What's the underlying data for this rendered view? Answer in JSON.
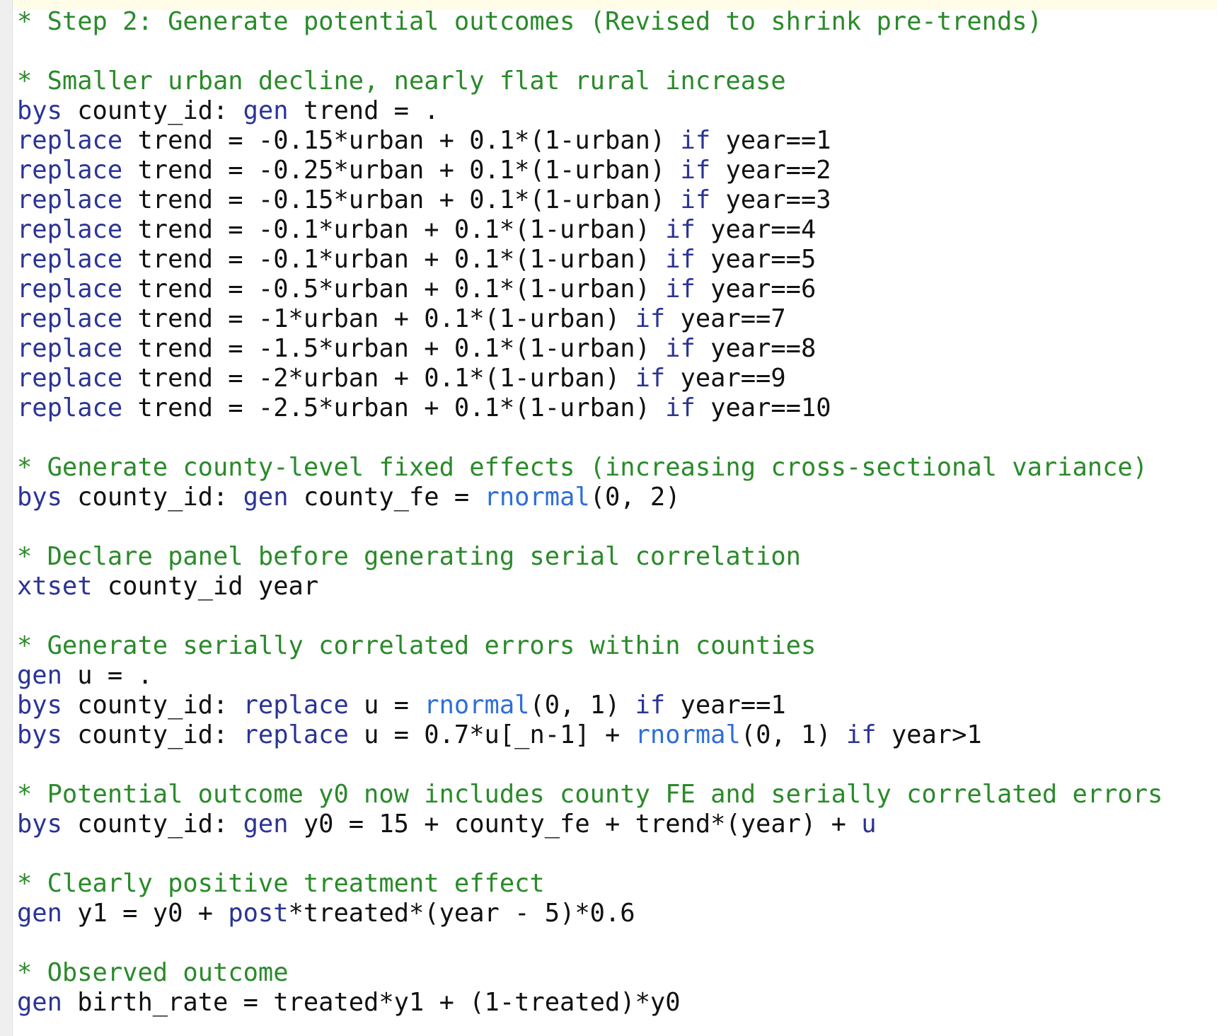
{
  "colors": {
    "comment": "#2a8a2a",
    "keyword": "#2b3494",
    "function": "#2e6fd8",
    "text": "#111111",
    "gutter": "#efefef",
    "background": "#ffffff"
  },
  "lines": [
    [
      {
        "t": "* Step 2: Generate potential outcomes (Revised to shrink pre-trends)",
        "c": "comment"
      }
    ],
    [],
    [
      {
        "t": "* Smaller urban decline, nearly flat rural increase",
        "c": "comment"
      }
    ],
    [
      {
        "t": "bys",
        "c": "kw"
      },
      {
        "t": " county_id: ",
        "c": "plain"
      },
      {
        "t": "gen",
        "c": "kw"
      },
      {
        "t": " trend = .",
        "c": "plain"
      }
    ],
    [
      {
        "t": "replace",
        "c": "kw"
      },
      {
        "t": " trend = -0.15*urban + 0.1*(1-urban) ",
        "c": "plain"
      },
      {
        "t": "if",
        "c": "kw"
      },
      {
        "t": " year==1",
        "c": "plain"
      }
    ],
    [
      {
        "t": "replace",
        "c": "kw"
      },
      {
        "t": " trend = -0.25*urban + 0.1*(1-urban) ",
        "c": "plain"
      },
      {
        "t": "if",
        "c": "kw"
      },
      {
        "t": " year==2",
        "c": "plain"
      }
    ],
    [
      {
        "t": "replace",
        "c": "kw"
      },
      {
        "t": " trend = -0.15*urban + 0.1*(1-urban) ",
        "c": "plain"
      },
      {
        "t": "if",
        "c": "kw"
      },
      {
        "t": " year==3",
        "c": "plain"
      }
    ],
    [
      {
        "t": "replace",
        "c": "kw"
      },
      {
        "t": " trend = -0.1*urban + 0.1*(1-urban) ",
        "c": "plain"
      },
      {
        "t": "if",
        "c": "kw"
      },
      {
        "t": " year==4",
        "c": "plain"
      }
    ],
    [
      {
        "t": "replace",
        "c": "kw"
      },
      {
        "t": " trend = -0.1*urban + 0.1*(1-urban) ",
        "c": "plain"
      },
      {
        "t": "if",
        "c": "kw"
      },
      {
        "t": " year==5",
        "c": "plain"
      }
    ],
    [
      {
        "t": "replace",
        "c": "kw"
      },
      {
        "t": " trend = -0.5*urban + 0.1*(1-urban) ",
        "c": "plain"
      },
      {
        "t": "if",
        "c": "kw"
      },
      {
        "t": " year==6",
        "c": "plain"
      }
    ],
    [
      {
        "t": "replace",
        "c": "kw"
      },
      {
        "t": " trend = -1*urban + 0.1*(1-urban) ",
        "c": "plain"
      },
      {
        "t": "if",
        "c": "kw"
      },
      {
        "t": " year==7",
        "c": "plain"
      }
    ],
    [
      {
        "t": "replace",
        "c": "kw"
      },
      {
        "t": " trend = -1.5*urban + 0.1*(1-urban) ",
        "c": "plain"
      },
      {
        "t": "if",
        "c": "kw"
      },
      {
        "t": " year==8",
        "c": "plain"
      }
    ],
    [
      {
        "t": "replace",
        "c": "kw"
      },
      {
        "t": " trend = -2*urban + 0.1*(1-urban) ",
        "c": "plain"
      },
      {
        "t": "if",
        "c": "kw"
      },
      {
        "t": " year==9",
        "c": "plain"
      }
    ],
    [
      {
        "t": "replace",
        "c": "kw"
      },
      {
        "t": " trend = -2.5*urban + 0.1*(1-urban) ",
        "c": "plain"
      },
      {
        "t": "if",
        "c": "kw"
      },
      {
        "t": " year==10",
        "c": "plain"
      }
    ],
    [],
    [
      {
        "t": "* Generate county-level fixed effects (increasing cross-sectional variance)",
        "c": "comment"
      }
    ],
    [
      {
        "t": "bys",
        "c": "kw"
      },
      {
        "t": " county_id: ",
        "c": "plain"
      },
      {
        "t": "gen",
        "c": "kw"
      },
      {
        "t": " county_fe = ",
        "c": "plain"
      },
      {
        "t": "rnormal",
        "c": "fn"
      },
      {
        "t": "(0, 2)",
        "c": "plain"
      }
    ],
    [],
    [
      {
        "t": "* Declare panel before generating serial correlation",
        "c": "comment"
      }
    ],
    [
      {
        "t": "xtset",
        "c": "kw"
      },
      {
        "t": " county_id year",
        "c": "plain"
      }
    ],
    [],
    [
      {
        "t": "* Generate serially correlated errors within counties",
        "c": "comment"
      }
    ],
    [
      {
        "t": "gen",
        "c": "kw"
      },
      {
        "t": " u = .",
        "c": "plain"
      }
    ],
    [
      {
        "t": "bys",
        "c": "kw"
      },
      {
        "t": " county_id: ",
        "c": "plain"
      },
      {
        "t": "replace",
        "c": "kw"
      },
      {
        "t": " u = ",
        "c": "plain"
      },
      {
        "t": "rnormal",
        "c": "fn"
      },
      {
        "t": "(0, 1) ",
        "c": "plain"
      },
      {
        "t": "if",
        "c": "kw"
      },
      {
        "t": " year==1",
        "c": "plain"
      }
    ],
    [
      {
        "t": "bys",
        "c": "kw"
      },
      {
        "t": " county_id: ",
        "c": "plain"
      },
      {
        "t": "replace",
        "c": "kw"
      },
      {
        "t": " u = 0.7*u[_n-1] + ",
        "c": "plain"
      },
      {
        "t": "rnormal",
        "c": "fn"
      },
      {
        "t": "(0, 1) ",
        "c": "plain"
      },
      {
        "t": "if",
        "c": "kw"
      },
      {
        "t": " year>1",
        "c": "plain"
      }
    ],
    [],
    [
      {
        "t": "* Potential outcome y0 now includes county FE and serially correlated errors",
        "c": "comment"
      }
    ],
    [
      {
        "t": "bys",
        "c": "kw"
      },
      {
        "t": " county_id: ",
        "c": "plain"
      },
      {
        "t": "gen",
        "c": "kw"
      },
      {
        "t": " y0 = 15 + county_fe + trend*(year) + ",
        "c": "plain"
      },
      {
        "t": "u",
        "c": "kw"
      }
    ],
    [],
    [
      {
        "t": "* Clearly positive treatment effect",
        "c": "comment"
      }
    ],
    [
      {
        "t": "gen",
        "c": "kw"
      },
      {
        "t": " y1 = y0 + ",
        "c": "plain"
      },
      {
        "t": "post",
        "c": "kw"
      },
      {
        "t": "*treated*(year - 5)*0.6",
        "c": "plain"
      }
    ],
    [],
    [
      {
        "t": "* Observed outcome",
        "c": "comment"
      }
    ],
    [
      {
        "t": "gen",
        "c": "kw"
      },
      {
        "t": " birth_rate = treated*y1 + (1-treated)*y0",
        "c": "plain"
      }
    ]
  ]
}
